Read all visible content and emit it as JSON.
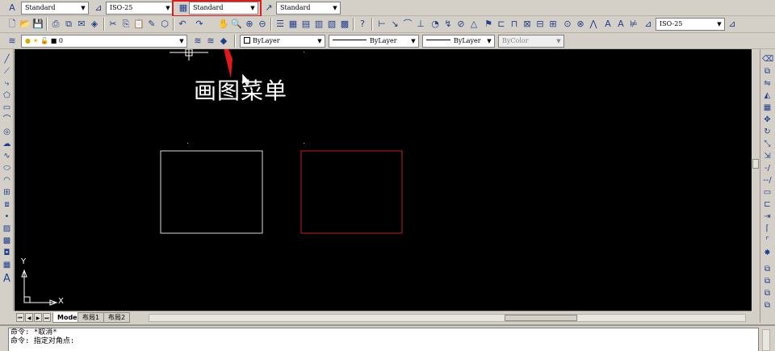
{
  "toolbar": {
    "text_style": "Standard",
    "dim_style": "ISO-25",
    "table_style": "Standard",
    "mleader_style": "Standard",
    "dim_style_right": "ISO-25",
    "highlight_color": "#e0191b"
  },
  "layers": {
    "current_layer": "0"
  },
  "properties": {
    "color": "ByLayer",
    "linetype": "ByLayer",
    "lineweight": "ByLayer",
    "plotstyle": "ByColor"
  },
  "annotation": {
    "text": "画图菜单",
    "arrow_color": "#e0191b"
  },
  "canvas": {
    "background": "#000000",
    "rect_left_color": "#d8d8d8",
    "rect_right_color": "#c0201e",
    "ucs_y": "Y",
    "ucs_x": "X"
  },
  "tabs": [
    {
      "label": "Model",
      "active": true
    },
    {
      "label": "布局1",
      "active": false
    },
    {
      "label": "布局2",
      "active": false
    }
  ],
  "command": {
    "lines": [
      "命令: *取消*",
      "命令: 指定对角点:"
    ]
  }
}
